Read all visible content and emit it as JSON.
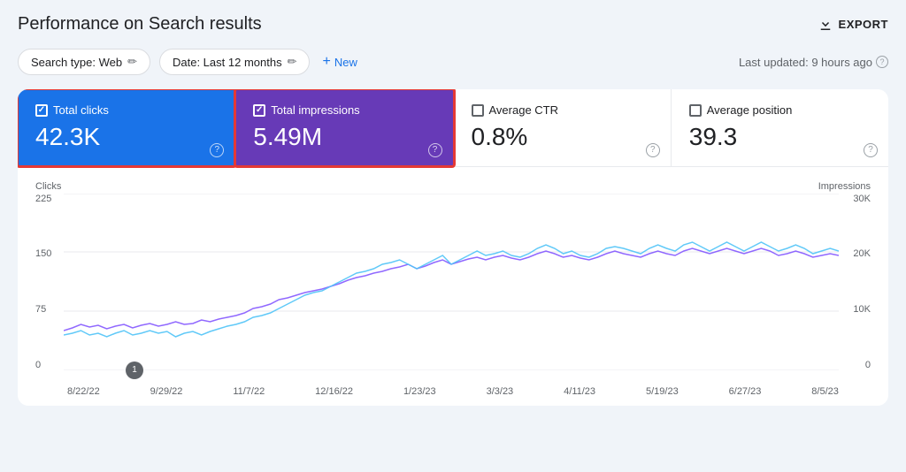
{
  "header": {
    "title": "Performance on Search results",
    "export_label": "EXPORT"
  },
  "toolbar": {
    "search_type_label": "Search type: Web",
    "date_label": "Date: Last 12 months",
    "add_label": "New",
    "last_updated": "Last updated: 9 hours ago"
  },
  "metrics": [
    {
      "id": "total-clicks",
      "label": "Total clicks",
      "value": "42.3K",
      "checked": true,
      "active": "blue"
    },
    {
      "id": "total-impressions",
      "label": "Total impressions",
      "value": "5.49M",
      "checked": true,
      "active": "purple"
    },
    {
      "id": "average-ctr",
      "label": "Average CTR",
      "value": "0.8%",
      "checked": false,
      "active": "none"
    },
    {
      "id": "average-position",
      "label": "Average position",
      "value": "39.3",
      "checked": false,
      "active": "none"
    }
  ],
  "chart": {
    "left_axis_title": "Clicks",
    "right_axis_title": "Impressions",
    "left_y_labels": [
      "225",
      "150",
      "75",
      "0"
    ],
    "right_y_labels": [
      "30K",
      "20K",
      "10K",
      "0"
    ],
    "x_labels": [
      "8/22/22",
      "9/29/22",
      "11/7/22",
      "12/16/22",
      "1/23/23",
      "3/3/23",
      "4/11/23",
      "5/19/23",
      "6/27/23",
      "8/5/23"
    ],
    "annotation": "1"
  }
}
